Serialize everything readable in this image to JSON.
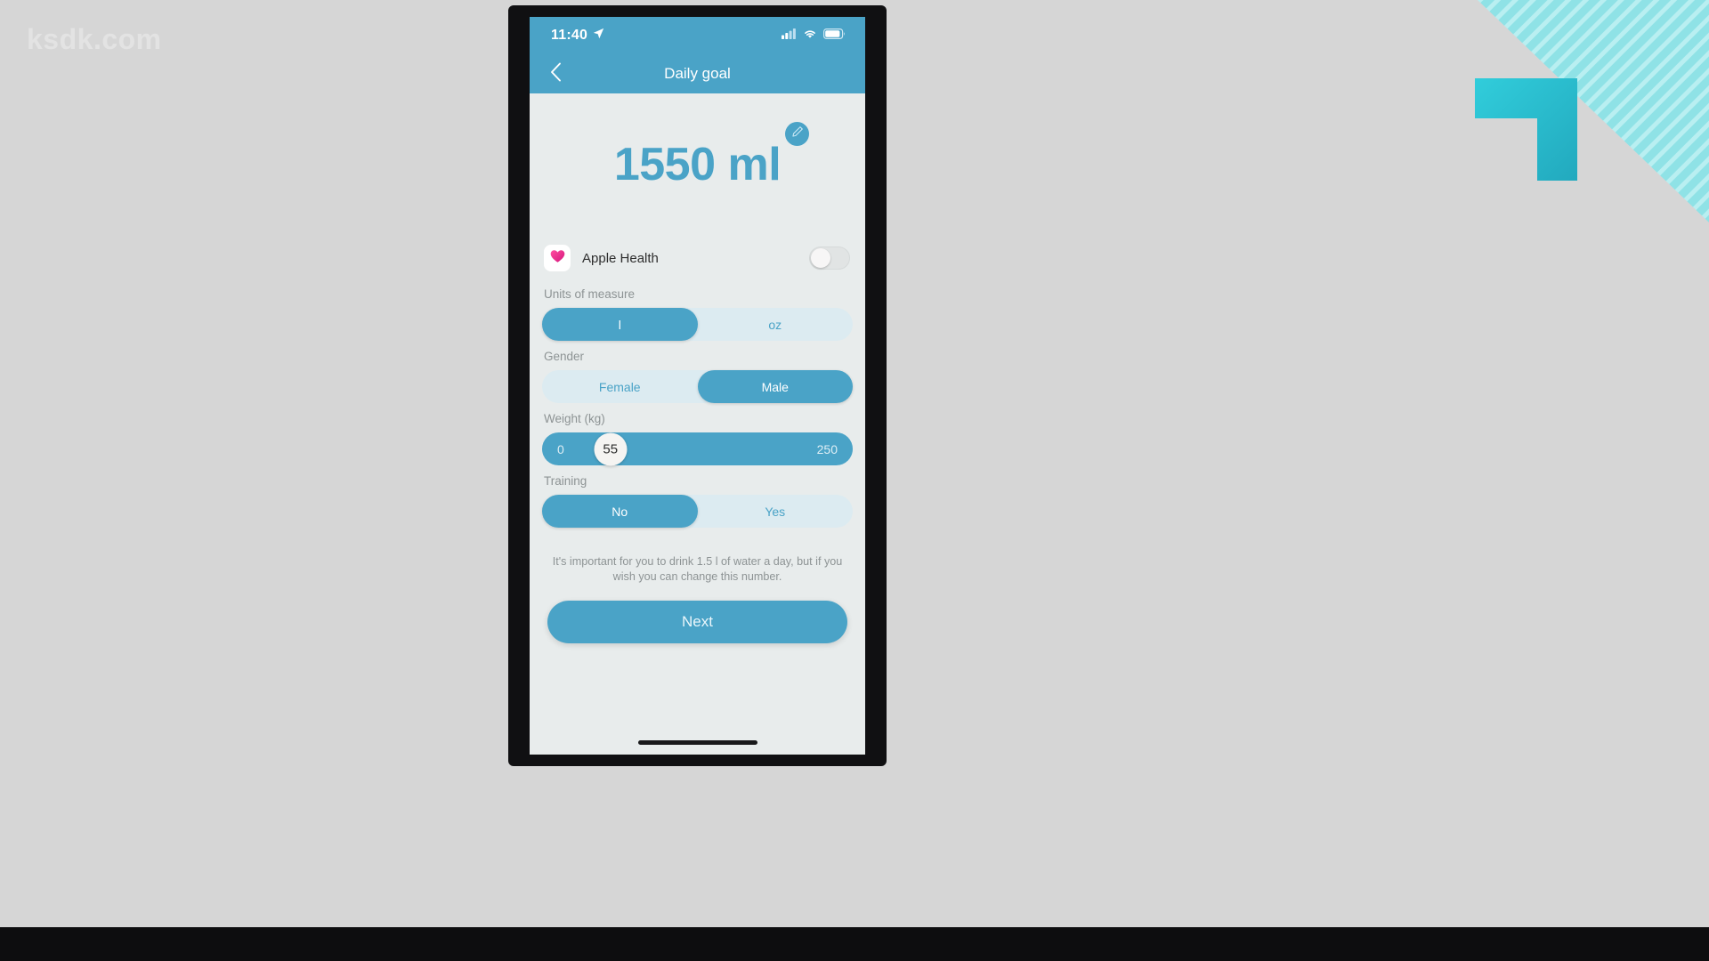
{
  "broadcast": {
    "watermark": "ksdk.com"
  },
  "statusbar": {
    "time": "11:40",
    "location_icon": "location-arrow-icon",
    "signal_icon": "cellular-signal-icon",
    "wifi_icon": "wifi-icon",
    "battery_icon": "battery-icon"
  },
  "navbar": {
    "back_icon": "chevron-left-icon",
    "title": "Daily goal"
  },
  "goal": {
    "value": "1550 ml",
    "edit_icon": "pencil-icon"
  },
  "apple_health": {
    "icon": "heart-icon",
    "label": "Apple Health",
    "toggle_state": "off"
  },
  "units": {
    "label": "Units of measure",
    "options": [
      {
        "label": "l",
        "selected": true
      },
      {
        "label": "oz",
        "selected": false
      }
    ]
  },
  "gender": {
    "label": "Gender",
    "options": [
      {
        "label": "Female",
        "selected": false
      },
      {
        "label": "Male",
        "selected": true
      }
    ]
  },
  "weight": {
    "label": "Weight (kg)",
    "min": "0",
    "max": "250",
    "value": "55",
    "knob_percent": 22
  },
  "training": {
    "label": "Training",
    "options": [
      {
        "label": "No",
        "selected": true
      },
      {
        "label": "Yes",
        "selected": false
      }
    ]
  },
  "note": {
    "text": "It's important for you to drink 1.5 l of water a day, but if you wish you can change this number."
  },
  "actions": {
    "next_label": "Next"
  },
  "colors": {
    "accent": "#4aa3c7",
    "accent_light": "#dcebf1",
    "screen_bg": "#e8ecec",
    "label_gray": "#8d9394",
    "heart_pink": "#ef3e8c",
    "decor_teal": "#2bc4d4"
  }
}
